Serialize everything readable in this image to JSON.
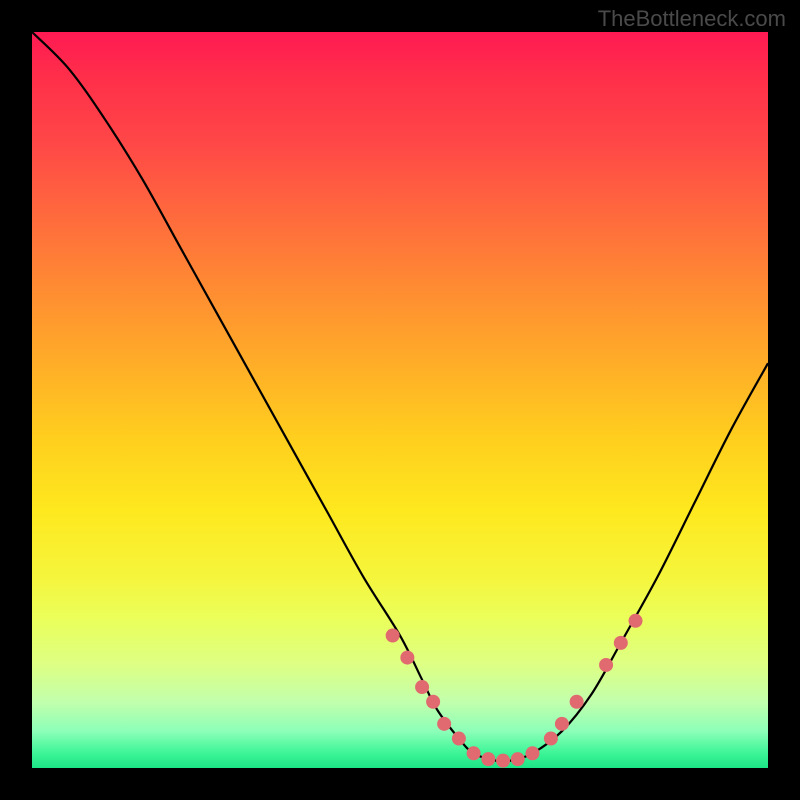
{
  "watermark": "TheBottleneck.com",
  "chart_data": {
    "type": "line",
    "title": "",
    "xlabel": "",
    "ylabel": "",
    "xlim": [
      0,
      100
    ],
    "ylim": [
      0,
      100
    ],
    "grid": false,
    "description": "Bottleneck curve — a steep valley shape where low y (green band near bottom) is optimal and high y (red band near top) is a bottleneck. Curve drops from top-left to a flat minimum near x≈55-65, then rises to the right.",
    "series": [
      {
        "name": "bottleneck-curve",
        "color": "#000000",
        "x": [
          0,
          5,
          10,
          15,
          20,
          25,
          30,
          35,
          40,
          45,
          50,
          53,
          55,
          58,
          60,
          63,
          65,
          68,
          72,
          76,
          80,
          85,
          90,
          95,
          100
        ],
        "y": [
          100,
          95,
          88,
          80,
          71,
          62,
          53,
          44,
          35,
          26,
          18,
          12,
          8,
          4,
          2,
          1,
          1,
          2,
          5,
          10,
          17,
          26,
          36,
          46,
          55
        ]
      }
    ],
    "markers": {
      "name": "datapoints-in-green-zone",
      "color": "#e06a6f",
      "radius": 7,
      "x": [
        49,
        51,
        53,
        54.5,
        56,
        58,
        60,
        62,
        64,
        66,
        68,
        70.5,
        72,
        74,
        78,
        80,
        82
      ],
      "y": [
        18,
        15,
        11,
        9,
        6,
        4,
        2,
        1.2,
        1,
        1.2,
        2,
        4,
        6,
        9,
        14,
        17,
        20
      ]
    },
    "background_gradient": {
      "stops": [
        {
          "pos": 0,
          "color": "#ff1a53"
        },
        {
          "pos": 15,
          "color": "#ff4747"
        },
        {
          "pos": 35,
          "color": "#ff8c32"
        },
        {
          "pos": 55,
          "color": "#ffce1e"
        },
        {
          "pos": 74,
          "color": "#f5f53c"
        },
        {
          "pos": 91,
          "color": "#c2ffac"
        },
        {
          "pos": 100,
          "color": "#1ce486"
        }
      ]
    }
  }
}
